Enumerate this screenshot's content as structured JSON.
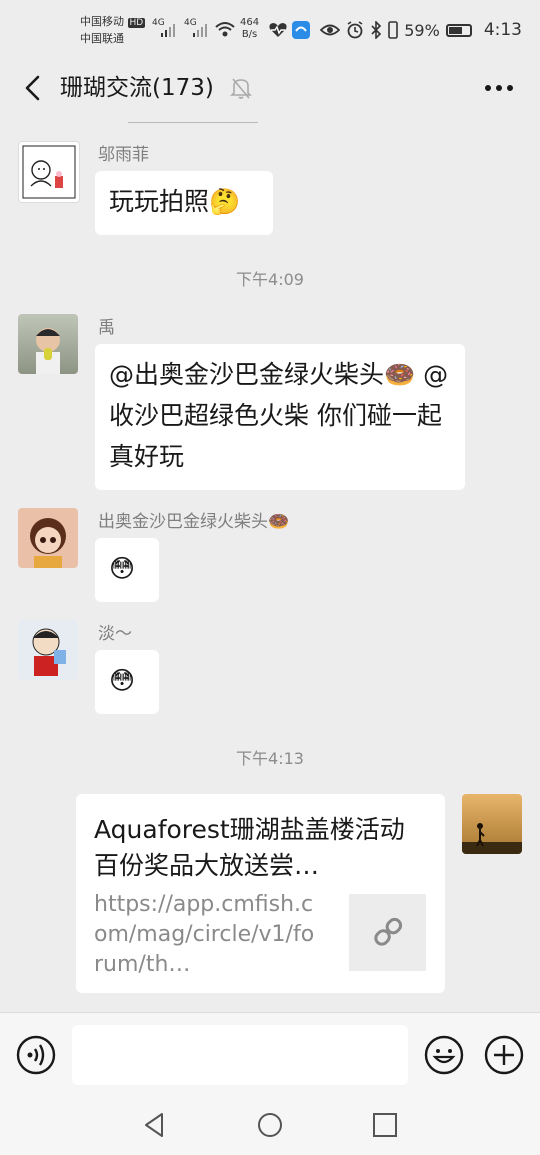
{
  "status_bar": {
    "carrier_1": "中国移动",
    "hd_badge": "HD",
    "carrier_2": "中国联通",
    "signal_1": "4G",
    "signal_2": "4G",
    "net_speed_value": "464",
    "net_speed_unit": "B/s",
    "battery_percent": "59%",
    "time": "4:13"
  },
  "header": {
    "title": "珊瑚交流(173)"
  },
  "messages": [
    {
      "sender": "邬雨菲",
      "text": "玩玩拍照🤔"
    },
    {
      "sender": "禹",
      "text": "@出奥金沙巴金绿火柴头🍩 @收沙巴超绿色火柴  你们碰一起真好玩"
    },
    {
      "sender": "出奥金沙巴金绿火柴头🍩",
      "text": "😳"
    },
    {
      "sender": "淡～",
      "text": "😳"
    }
  ],
  "timestamps": [
    "下午4:09",
    "下午4:13"
  ],
  "link_card": {
    "title": "Aquaforest珊湖盐盖楼活动 百份奖品大放送尝…",
    "url": "https://app.cmfish.com/mag/circle/v1/forum/th…"
  },
  "input_bar": {
    "input_value": "",
    "icons": [
      "voice-icon",
      "emoji-icon",
      "plus-icon"
    ]
  },
  "nav_bar": {
    "icons": [
      "back-triangle-icon",
      "home-circle-icon",
      "recent-square-icon"
    ]
  },
  "colors": {
    "background": "#ededed",
    "bubble": "#ffffff",
    "text": "#191919",
    "meta_text": "#7f7f7f"
  }
}
